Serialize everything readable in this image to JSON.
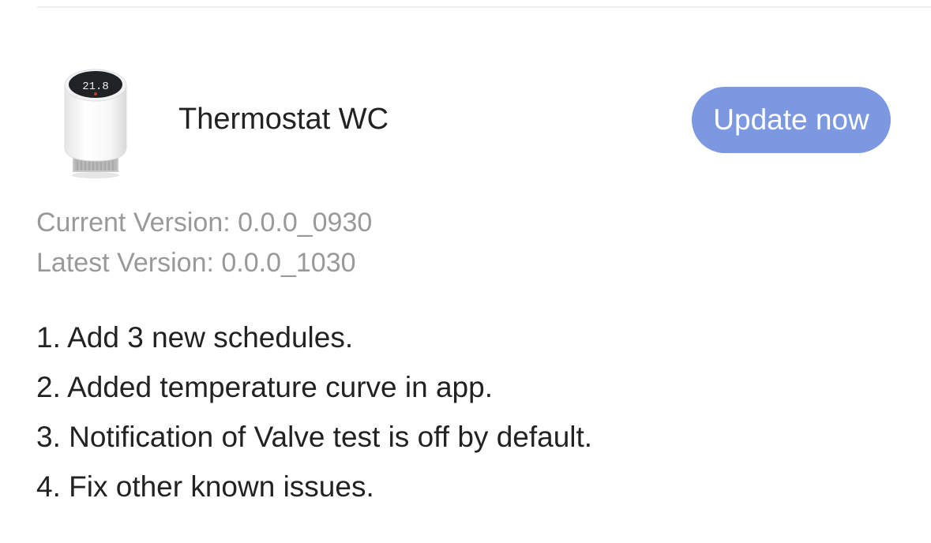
{
  "device": {
    "name": "Thermostat WC",
    "display_reading": "21.8"
  },
  "update_button": {
    "label": "Update now",
    "color": "#7b98e1"
  },
  "versions": {
    "current": "Current Version: 0.0.0_0930",
    "latest": "Latest Version: 0.0.0_1030"
  },
  "release_notes": [
    "1. Add 3 new schedules.",
    "2. Added temperature curve in app.",
    "3. Notification of Valve test is off by default.",
    "4. Fix other known issues."
  ]
}
